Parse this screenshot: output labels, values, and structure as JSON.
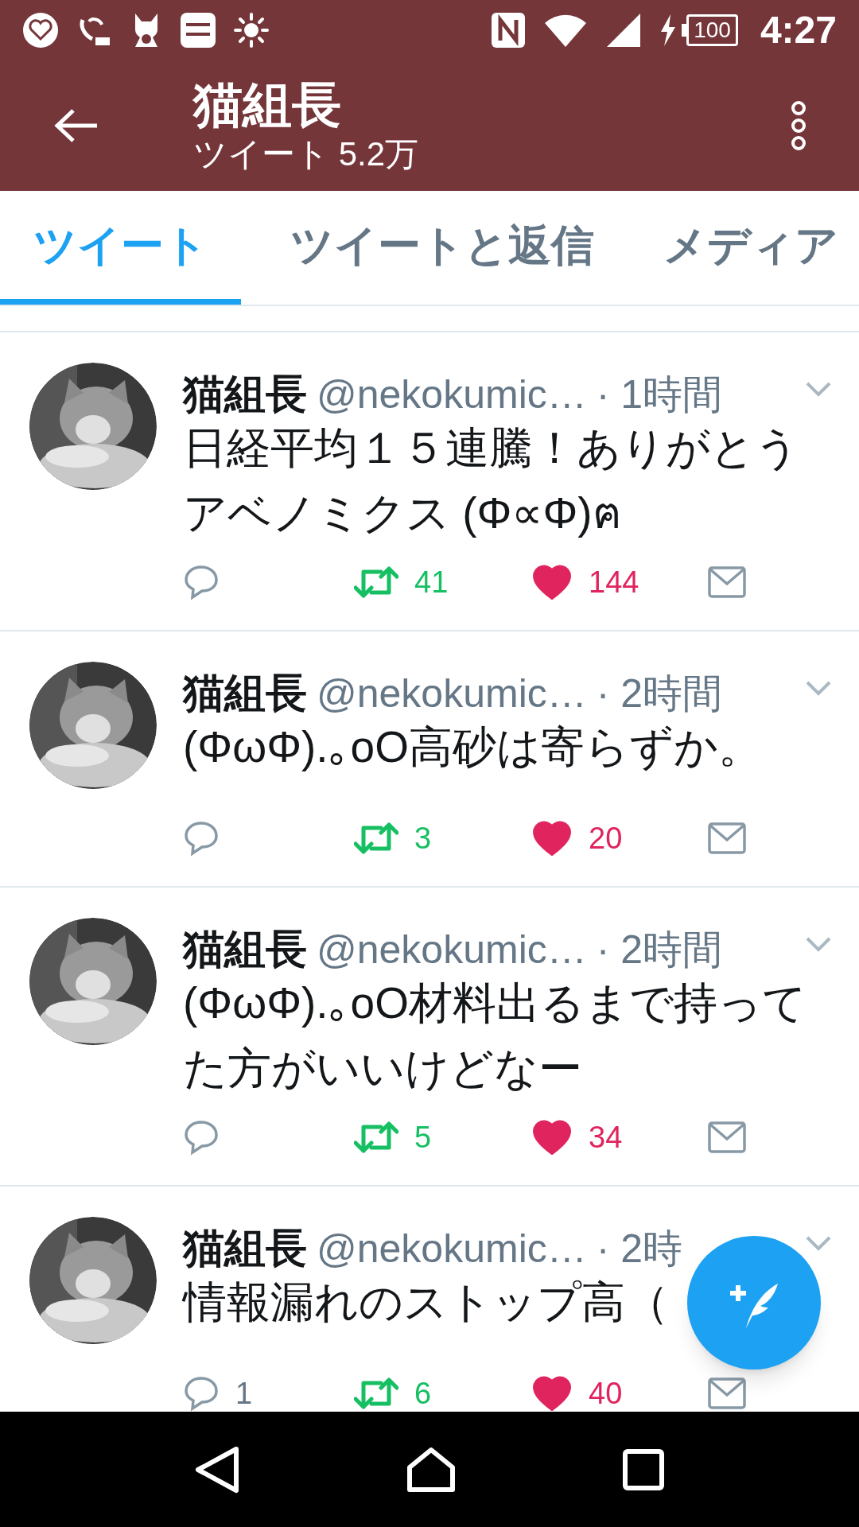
{
  "status_bar": {
    "battery": "100",
    "time": "4:27"
  },
  "header": {
    "title": "猫組長",
    "subtitle": "ツイート 5.2万"
  },
  "tabs": [
    {
      "label": "ツイート",
      "selected": true
    },
    {
      "label": "ツイートと返信",
      "selected": false
    },
    {
      "label": "メディア",
      "selected": false
    }
  ],
  "tweets": [
    {
      "name": "猫組長",
      "handle": "@nekokumic…",
      "time": "· 1時間",
      "text": "日経平均１５連騰！ありがとうアベノミクス (Φ∝Φ)ฅ",
      "retweets": "41",
      "retweeted": true,
      "likes": "144",
      "liked": true
    },
    {
      "name": "猫組長",
      "handle": "@nekokumic…",
      "time": "· 2時間",
      "text": "(ΦωΦ).｡oO高砂は寄らずか。",
      "retweets": "3",
      "retweeted": true,
      "likes": "20",
      "liked": true
    },
    {
      "name": "猫組長",
      "handle": "@nekokumic…",
      "time": "· 2時間",
      "text": "(ΦωΦ).｡oO材料出るまで持ってた方がいいけどなー",
      "retweets": "5",
      "retweeted": true,
      "likes": "34",
      "liked": true
    },
    {
      "name": "猫組長",
      "handle": "@nekokumic…",
      "time": "· 2時",
      "text": "情報漏れのストップ高（",
      "replies": "1",
      "retweets": "6",
      "retweeted": true,
      "likes": "40",
      "liked": true
    }
  ]
}
